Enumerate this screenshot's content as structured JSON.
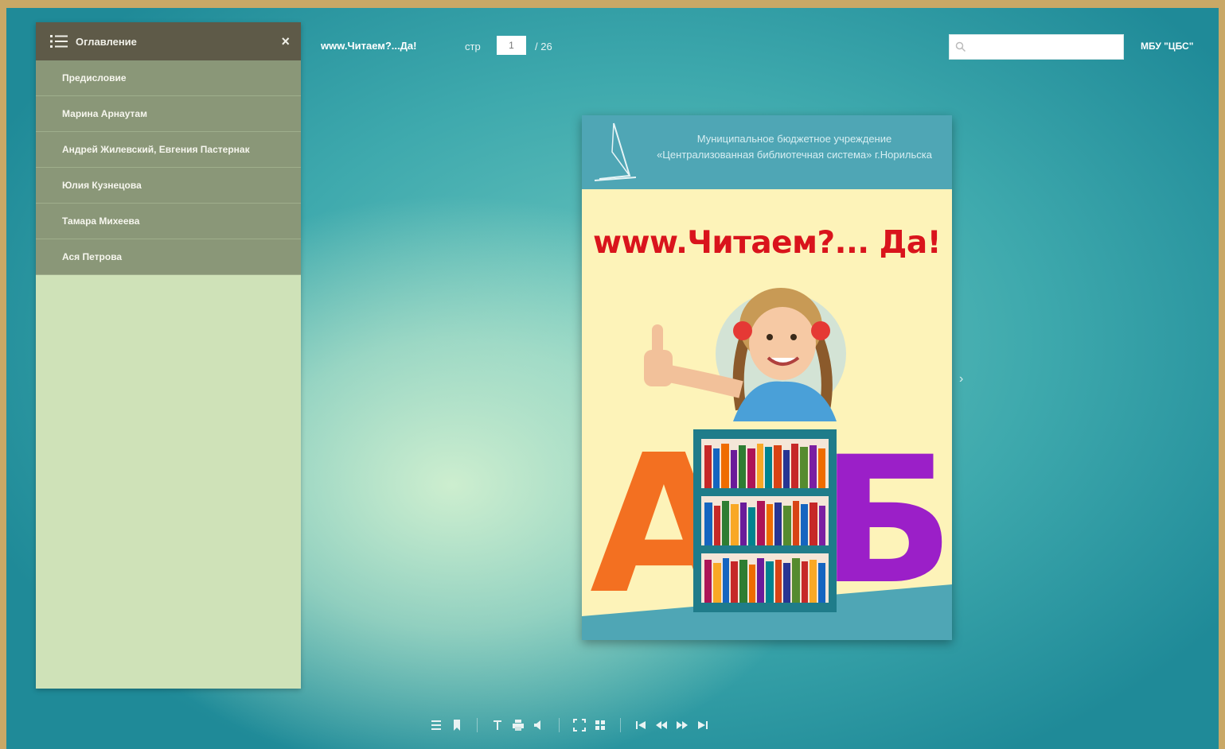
{
  "toc": {
    "title": "Оглавление",
    "close_label": "×",
    "items": [
      {
        "label": "Предисловие"
      },
      {
        "label": "Марина Арнаутам"
      },
      {
        "label": "Андрей Жилевский, Евгения Пастернак"
      },
      {
        "label": "Юлия Кузнецова"
      },
      {
        "label": "Тамара Михеева"
      },
      {
        "label": "Ася Петрова"
      }
    ]
  },
  "topbar": {
    "book_title": "www.Читаем?...Да!",
    "page_label": "стр",
    "page_value": "1",
    "page_total": "/ 26",
    "search_placeholder": "",
    "org": "МБУ \"ЦБС\""
  },
  "book_page": {
    "header_text": "Муниципальное бюджетное учреждение «Централизованная библиотечная система» г.Норильска",
    "title": "www.Читаем?... Да!",
    "letter_a": "А",
    "letter_b": "Б"
  },
  "colors": {
    "sidebar_header": "#5e5a48",
    "sidebar_item": "#8a9778",
    "title_red": "#d9141c",
    "letter_orange": "#f37021",
    "letter_purple": "#9b1fc8"
  },
  "toolbar_icons": [
    "toc-icon",
    "bookmark-icon",
    "text-icon",
    "print-icon",
    "sound-icon",
    "fullscreen-icon",
    "thumbnails-icon",
    "first-page-icon",
    "prev-page-icon",
    "next-page-icon",
    "last-page-icon"
  ]
}
